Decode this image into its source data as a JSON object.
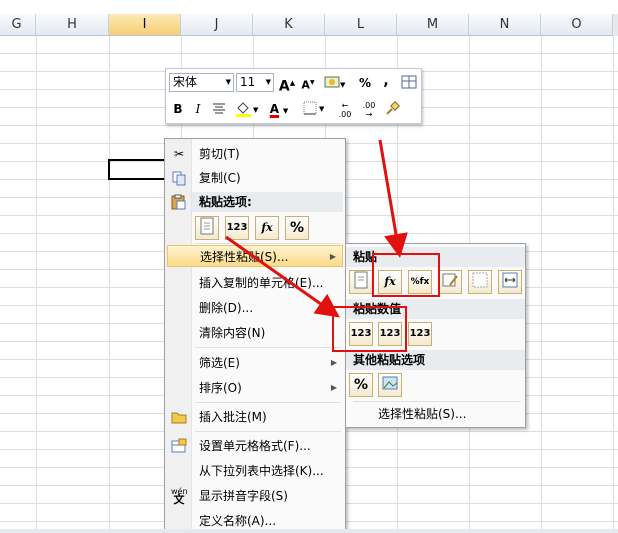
{
  "columns": [
    "G",
    "H",
    "I",
    "J",
    "K",
    "L",
    "M",
    "N",
    "O"
  ],
  "mini_toolbar": {
    "font_name": "宋体",
    "font_size": "11",
    "grow_font": "A",
    "shrink_font": "A",
    "percent": "%",
    "comma": ",",
    "bold": "B",
    "italic": "I",
    "font_color_letter": "A",
    "inc_decimal": ".00",
    "dec_decimal": ".00"
  },
  "context_menu": {
    "cut": "剪切(T)",
    "copy": "复制(C)",
    "paste_options_header": "粘贴选项:",
    "paste_special": "选择性粘贴(S)...",
    "insert_copied": "插入复制的单元格(E)...",
    "delete": "删除(D)...",
    "clear": "清除内容(N)",
    "filter": "筛选(E)",
    "sort": "排序(O)",
    "insert_comment": "插入批注(M)",
    "format_cells": "设置单元格格式(F)...",
    "pick_list": "从下拉列表中选择(K)...",
    "phonetic": "显示拼音字段(S)",
    "define_name": "定义名称(A)...",
    "paste_icons": [
      "paste",
      "123",
      "fx",
      "%"
    ]
  },
  "submenu": {
    "paste_header": "粘贴",
    "values_header": "粘贴数值",
    "other_header": "其他粘贴选项",
    "paste_special": "选择性粘贴(S)...",
    "value_icons": [
      "123",
      "123",
      "123"
    ]
  },
  "icon_glyphs": {
    "fx": "fx",
    "pct_fx": "%fx",
    "v123": "123",
    "pct": "%"
  }
}
